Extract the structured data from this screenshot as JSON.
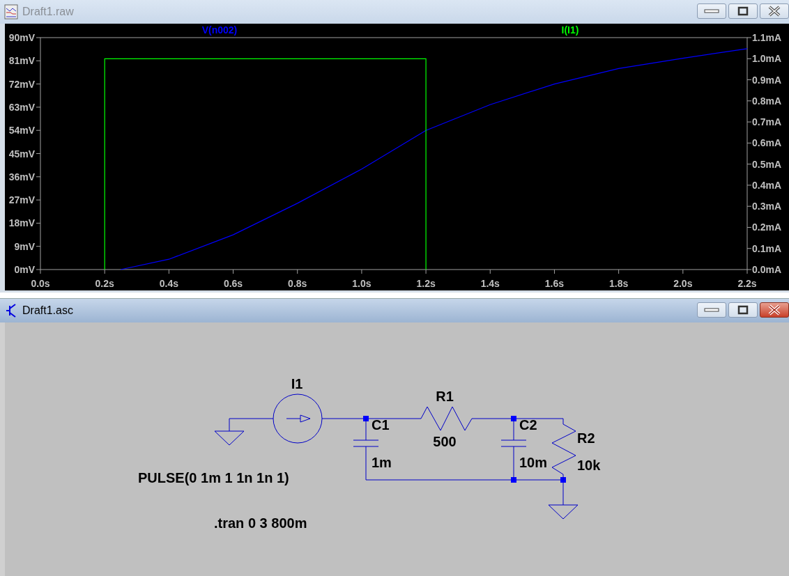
{
  "plot_window": {
    "title": "Draft1.raw",
    "active": false,
    "chart_data": {
      "type": "line",
      "x": [
        0.2,
        0.2,
        0.25,
        0.4,
        0.6,
        0.8,
        1.0,
        1.2,
        1.2,
        1.4,
        1.6,
        1.8,
        2.0,
        2.2
      ],
      "series": [
        {
          "name": "V(n002)",
          "color": "#0000ff",
          "values": [
            null,
            null,
            0,
            4,
            13.5,
            25.7,
            39,
            54,
            54,
            64,
            72,
            78,
            82,
            85.7
          ]
        },
        {
          "name": "I(I1)",
          "color": "#00ff00",
          "axis": "y2",
          "values": [
            0,
            1.0,
            1.0,
            1.0,
            1.0,
            1.0,
            1.0,
            1.0,
            0,
            null,
            null,
            null,
            null,
            null
          ]
        }
      ],
      "xlim": [
        0,
        2.2
      ],
      "xticks": [
        {
          "value": 0,
          "label": "0.0s"
        },
        {
          "value": 0.2,
          "label": "0.2s"
        },
        {
          "value": 0.4,
          "label": "0.4s"
        },
        {
          "value": 0.6,
          "label": "0.6s"
        },
        {
          "value": 0.8,
          "label": "0.8s"
        },
        {
          "value": 1.0,
          "label": "1.0s"
        },
        {
          "value": 1.2,
          "label": "1.2s"
        },
        {
          "value": 1.4,
          "label": "1.4s"
        },
        {
          "value": 1.6,
          "label": "1.6s"
        },
        {
          "value": 1.8,
          "label": "1.8s"
        },
        {
          "value": 2.0,
          "label": "2.0s"
        },
        {
          "value": 2.2,
          "label": "2.2s"
        }
      ],
      "ylim": [
        0,
        90
      ],
      "yticks": [
        {
          "value": 0,
          "label": "0mV"
        },
        {
          "value": 9,
          "label": "9mV"
        },
        {
          "value": 18,
          "label": "18mV"
        },
        {
          "value": 27,
          "label": "27mV"
        },
        {
          "value": 36,
          "label": "36mV"
        },
        {
          "value": 45,
          "label": "45mV"
        },
        {
          "value": 54,
          "label": "54mV"
        },
        {
          "value": 63,
          "label": "63mV"
        },
        {
          "value": 72,
          "label": "72mV"
        },
        {
          "value": 81,
          "label": "81mV"
        },
        {
          "value": 90,
          "label": "90mV"
        }
      ],
      "y2lim": [
        0,
        1.1
      ],
      "y2ticks": [
        {
          "value": 0,
          "label": "0.0mA"
        },
        {
          "value": 0.1,
          "label": "0.1mA"
        },
        {
          "value": 0.2,
          "label": "0.2mA"
        },
        {
          "value": 0.3,
          "label": "0.3mA"
        },
        {
          "value": 0.4,
          "label": "0.4mA"
        },
        {
          "value": 0.5,
          "label": "0.5mA"
        },
        {
          "value": 0.6,
          "label": "0.6mA"
        },
        {
          "value": 0.7,
          "label": "0.7mA"
        },
        {
          "value": 0.8,
          "label": "0.8mA"
        },
        {
          "value": 0.9,
          "label": "0.9mA"
        },
        {
          "value": 1.0,
          "label": "1.0mA"
        },
        {
          "value": 1.1,
          "label": "1.1mA"
        }
      ]
    }
  },
  "schematic_window": {
    "title": "Draft1.asc",
    "active": true,
    "components": [
      {
        "kind": "ground"
      },
      {
        "kind": "current_source",
        "ref": "I1",
        "value": "PULSE(0 1m 1 1n 1n 1)"
      },
      {
        "kind": "capacitor",
        "ref": "C1",
        "value": "1m"
      },
      {
        "kind": "resistor",
        "ref": "R1",
        "value": "500"
      },
      {
        "kind": "capacitor",
        "ref": "C2",
        "value": "10m"
      },
      {
        "kind": "resistor",
        "ref": "R2",
        "value": "10k"
      },
      {
        "kind": "ground"
      }
    ],
    "directives": [
      ".tran 0 3 800m"
    ]
  }
}
